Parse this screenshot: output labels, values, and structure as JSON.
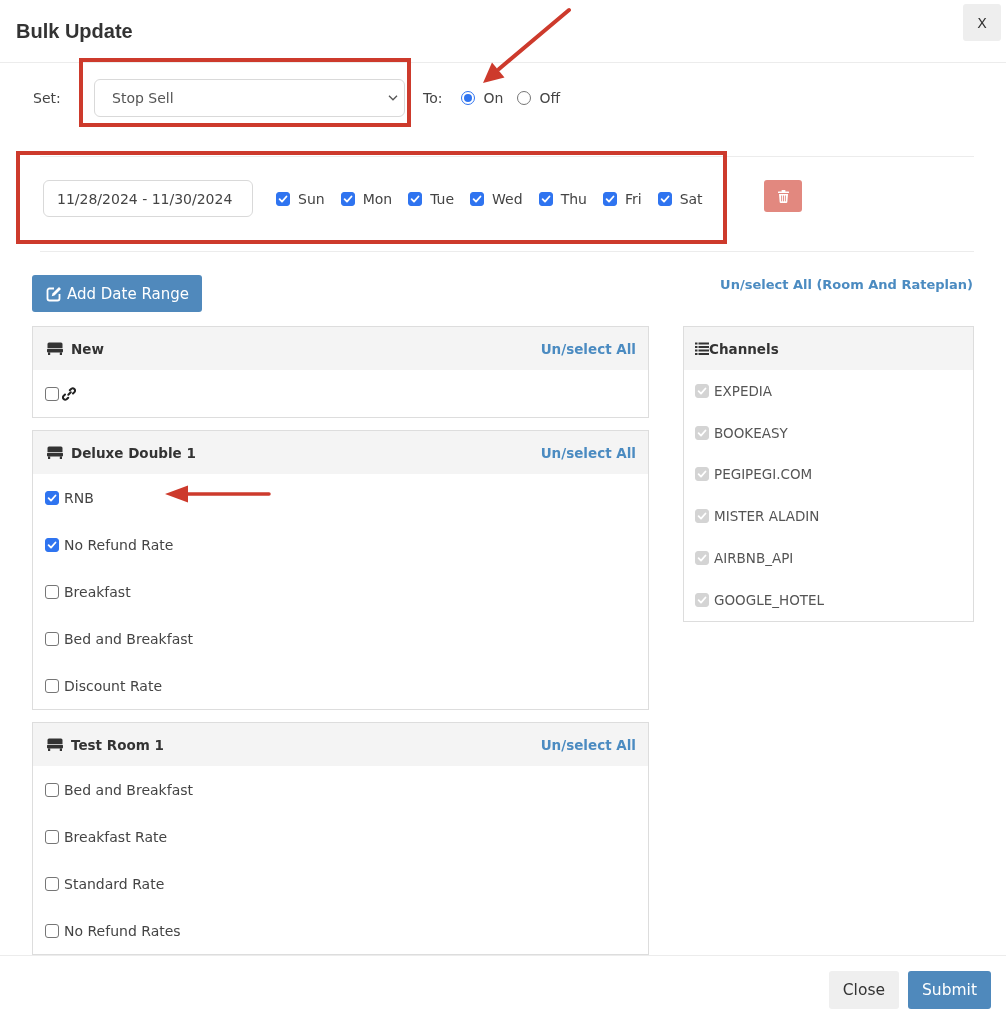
{
  "dialog": {
    "title": "Bulk Update",
    "close_label": "X"
  },
  "set_row": {
    "label": "Set:",
    "field": {
      "value": "Stop Sell"
    },
    "to_label": "To:",
    "options": [
      {
        "label": "On",
        "selected": true
      },
      {
        "label": "Off",
        "selected": false
      }
    ]
  },
  "date_ranges": [
    {
      "value": "11/28/2024 - 11/30/2024",
      "days": [
        {
          "label": "Sun",
          "checked": true
        },
        {
          "label": "Mon",
          "checked": true
        },
        {
          "label": "Tue",
          "checked": true
        },
        {
          "label": "Wed",
          "checked": true
        },
        {
          "label": "Thu",
          "checked": true
        },
        {
          "label": "Fri",
          "checked": true
        },
        {
          "label": "Sat",
          "checked": true
        }
      ]
    }
  ],
  "add_date_range_button": {
    "label": "Add Date Range"
  },
  "select_all_link": "Un/select All (Room And Rateplan)",
  "rooms": [
    {
      "name": "New",
      "toggle_link": "Un/select All",
      "rates": [
        {
          "kind": "link",
          "checked": false
        }
      ]
    },
    {
      "name": "Deluxe Double 1",
      "toggle_link": "Un/select All",
      "rates": [
        {
          "kind": "text",
          "label": "RNB",
          "checked": true
        },
        {
          "kind": "text",
          "label": "No Refund Rate",
          "checked": true
        },
        {
          "kind": "text",
          "label": "Breakfast",
          "checked": false
        },
        {
          "kind": "text",
          "label": "Bed and Breakfast",
          "checked": false
        },
        {
          "kind": "text",
          "label": "Discount Rate",
          "checked": false
        }
      ]
    },
    {
      "name": "Test Room 1",
      "toggle_link": "Un/select All",
      "rates": [
        {
          "kind": "text",
          "label": "Bed and Breakfast",
          "checked": false
        },
        {
          "kind": "text",
          "label": "Breakfast Rate",
          "checked": false
        },
        {
          "kind": "text",
          "label": "Standard Rate",
          "checked": false
        },
        {
          "kind": "text",
          "label": "No Refund Rates",
          "checked": false
        }
      ]
    }
  ],
  "channels": {
    "title": "Channels",
    "items": [
      {
        "label": "EXPEDIA",
        "checked": true,
        "disabled": true
      },
      {
        "label": "BOOKEASY",
        "checked": true,
        "disabled": true
      },
      {
        "label": "PEGIPEGI.COM",
        "checked": true,
        "disabled": true
      },
      {
        "label": "MISTER ALADIN",
        "checked": true,
        "disabled": true
      },
      {
        "label": "AIRBNB_API",
        "checked": true,
        "disabled": true
      },
      {
        "label": "GOOGLE_HOTEL",
        "checked": true,
        "disabled": true
      }
    ]
  },
  "footer": {
    "buttons": [
      {
        "label": "Close",
        "kind": "secondary"
      },
      {
        "label": "Submit",
        "kind": "primary"
      }
    ]
  }
}
